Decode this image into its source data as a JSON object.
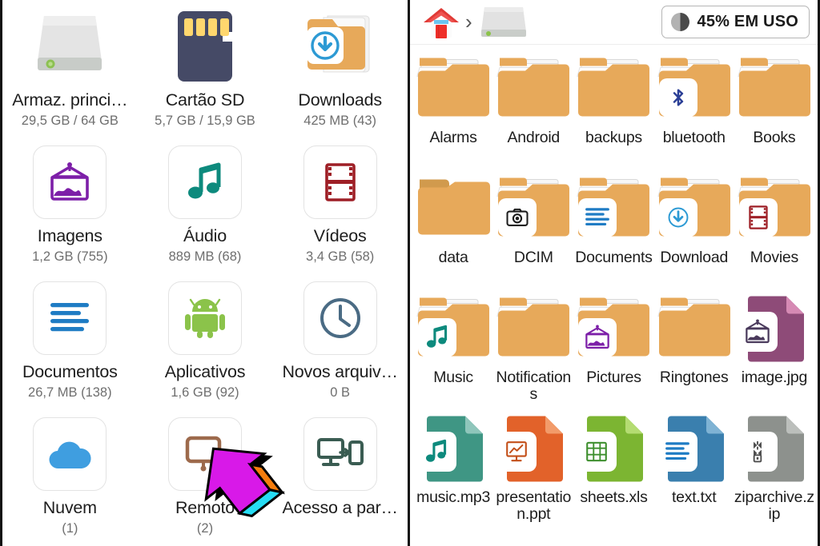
{
  "app": {
    "title": "File Manager",
    "divider_color": "#111111",
    "folder_color": "#e7a95a",
    "accent_blue": "#2d8fd0"
  },
  "left_panel": {
    "name": "storage-overview",
    "items": [
      {
        "name": "Armaz. princi…",
        "sub": "29,5 GB / 64 GB",
        "icon": "hard-drive-icon",
        "tile": false
      },
      {
        "name": "Cartão SD",
        "sub": "5,7 GB / 15,9 GB",
        "icon": "sd-card-icon",
        "tile": false
      },
      {
        "name": "Downloads",
        "sub": "425 MB (43)",
        "icon": "downloads-folder-icon",
        "tile": false
      },
      {
        "name": "Imagens",
        "sub": "1,2 GB (755)",
        "icon": "picture-icon",
        "tile": true
      },
      {
        "name": "Áudio",
        "sub": "889 MB (68)",
        "icon": "music-note-icon",
        "tile": true
      },
      {
        "name": "Vídeos",
        "sub": "3,4 GB (58)",
        "icon": "film-icon",
        "tile": true
      },
      {
        "name": "Documentos",
        "sub": "26,7 MB (138)",
        "icon": "document-lines-icon",
        "tile": true
      },
      {
        "name": "Aplicativos",
        "sub": "1,6 GB (92)",
        "icon": "android-icon",
        "tile": true
      },
      {
        "name": "Novos arquiv…",
        "sub": "0 B",
        "icon": "clock-icon",
        "tile": true
      },
      {
        "name": "Nuvem",
        "sub": "(1)",
        "icon": "cloud-icon",
        "tile": true
      },
      {
        "name": "Remoto",
        "sub": "(2)",
        "icon": "remote-monitor-icon",
        "tile": true
      },
      {
        "name": "Acesso a par…",
        "sub": "",
        "icon": "screen-share-icon",
        "tile": true
      }
    ]
  },
  "right_panel": {
    "breadcrumb": {
      "home_icon": "home-icon",
      "separator": "›",
      "current_icon": "hard-drive-icon"
    },
    "usage_badge": {
      "label": "45% EM USO",
      "percent": 45,
      "icon": "pie-chart-icon"
    },
    "files": [
      {
        "name": "Alarms",
        "type": "folder",
        "badge": "none"
      },
      {
        "name": "Android",
        "type": "folder",
        "badge": "none"
      },
      {
        "name": "backups",
        "type": "folder",
        "badge": "none"
      },
      {
        "name": "bluetooth",
        "type": "folder",
        "badge": "bluetooth-icon"
      },
      {
        "name": "Books",
        "type": "folder",
        "badge": "none"
      },
      {
        "name": "data",
        "type": "folder-plain",
        "badge": "none"
      },
      {
        "name": "DCIM",
        "type": "folder",
        "badge": "camera-icon"
      },
      {
        "name": "Documents",
        "type": "folder",
        "badge": "document-lines-icon"
      },
      {
        "name": "Download",
        "type": "folder",
        "badge": "download-arrow-icon"
      },
      {
        "name": "Movies",
        "type": "folder",
        "badge": "film-icon"
      },
      {
        "name": "Music",
        "type": "folder",
        "badge": "music-note-icon"
      },
      {
        "name": "Notifications",
        "type": "folder",
        "badge": "none"
      },
      {
        "name": "Pictures",
        "type": "folder",
        "badge": "picture-icon"
      },
      {
        "name": "Ringtones",
        "type": "folder",
        "badge": "none"
      },
      {
        "name": "image.jpg",
        "type": "file-image",
        "badge": "picture-icon"
      },
      {
        "name": "music.mp3",
        "type": "file-audio",
        "badge": "music-note-icon"
      },
      {
        "name": "presentation.ppt",
        "type": "file-presentation",
        "badge": "presentation-icon"
      },
      {
        "name": "sheets.xls",
        "type": "file-spreadsheet",
        "badge": "grid-table-icon"
      },
      {
        "name": "text.txt",
        "type": "file-text",
        "badge": "document-lines-icon"
      },
      {
        "name": "ziparchive.zip",
        "type": "file-archive",
        "badge": "zipper-icon"
      }
    ]
  },
  "cursors": [
    {
      "name": "cursor-arrow-left-panel",
      "points_to": "Remoto"
    },
    {
      "name": "cursor-arrow-right-panel",
      "points_to": "Ringtones"
    }
  ]
}
